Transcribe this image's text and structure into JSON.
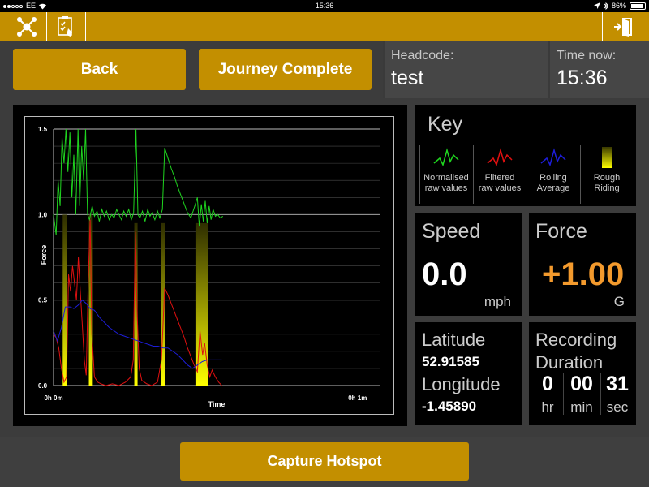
{
  "status_bar": {
    "carrier": "EE",
    "time": "15:36",
    "battery": "86%",
    "battery_fraction": 0.86
  },
  "toolbar": {
    "left_icons": [
      "network-icon",
      "checklist-icon"
    ],
    "right_icon": "exit-door-icon"
  },
  "header": {
    "back_label": "Back",
    "journey_label": "Journey Complete",
    "headcode_label": "Headcode:",
    "headcode_value": "test",
    "time_label": "Time now:",
    "time_value": "15:36"
  },
  "chart_data": {
    "type": "line",
    "xlabel": "Time",
    "ylabel": "Force",
    "x_tick_labels": [
      "0h 0m",
      "0h 1m"
    ],
    "y_ticks": [
      "0.0",
      "0.5",
      "1.0",
      "1.5"
    ],
    "ylim": [
      0,
      1.5
    ],
    "xlim": [
      0,
      1
    ],
    "grid": true,
    "series": [
      {
        "name": "Normalised raw values",
        "color": "#1fd41f",
        "points": [
          [
            0.0,
            1.0
          ],
          [
            0.008,
            0.88
          ],
          [
            0.014,
            1.2
          ],
          [
            0.02,
            1.05
          ],
          [
            0.026,
            1.45
          ],
          [
            0.032,
            1.3
          ],
          [
            0.038,
            1.52
          ],
          [
            0.044,
            1.25
          ],
          [
            0.05,
            1.48
          ],
          [
            0.056,
            1.1
          ],
          [
            0.062,
            1.35
          ],
          [
            0.068,
            1.0
          ],
          [
            0.075,
            1.5
          ],
          [
            0.08,
            1.05
          ],
          [
            0.086,
            1.4
          ],
          [
            0.092,
            1.2
          ],
          [
            0.098,
            1.52
          ],
          [
            0.104,
            1.0
          ],
          [
            0.11,
            0.97
          ],
          [
            0.118,
            1.05
          ],
          [
            0.125,
            0.99
          ],
          [
            0.133,
            1.02
          ],
          [
            0.14,
            0.96
          ],
          [
            0.148,
            1.03
          ],
          [
            0.155,
            0.99
          ],
          [
            0.162,
            1.02
          ],
          [
            0.17,
            0.97
          ],
          [
            0.178,
            1.0
          ],
          [
            0.185,
            0.98
          ],
          [
            0.193,
            1.03
          ],
          [
            0.2,
            1.0
          ],
          [
            0.208,
            0.97
          ],
          [
            0.215,
            1.02
          ],
          [
            0.222,
            0.99
          ],
          [
            0.23,
            1.03
          ],
          [
            0.238,
            0.97
          ],
          [
            0.245,
            1.01
          ],
          [
            0.252,
            1.52
          ],
          [
            0.258,
            1.0
          ],
          [
            0.264,
            0.98
          ],
          [
            0.272,
            1.02
          ],
          [
            0.28,
            0.96
          ],
          [
            0.288,
            1.03
          ],
          [
            0.295,
            0.99
          ],
          [
            0.302,
            1.01
          ],
          [
            0.31,
            0.97
          ],
          [
            0.318,
            1.02
          ],
          [
            0.325,
            0.98
          ],
          [
            0.333,
            1.03
          ],
          [
            0.34,
            1.39
          ],
          [
            0.35,
            1.33
          ],
          [
            0.36,
            1.27
          ],
          [
            0.37,
            1.22
          ],
          [
            0.38,
            1.16
          ],
          [
            0.39,
            1.11
          ],
          [
            0.4,
            1.06
          ],
          [
            0.41,
            1.01
          ],
          [
            0.42,
            0.98
          ],
          [
            0.432,
            1.05
          ],
          [
            0.44,
            1.1
          ],
          [
            0.446,
            0.93
          ],
          [
            0.452,
            1.06
          ],
          [
            0.458,
            0.96
          ],
          [
            0.464,
            1.08
          ],
          [
            0.47,
            0.95
          ],
          [
            0.476,
            1.05
          ],
          [
            0.482,
            0.97
          ],
          [
            0.488,
            1.03
          ],
          [
            0.495,
            0.99
          ],
          [
            0.502,
            1.0
          ],
          [
            0.51,
            0.98
          ],
          [
            0.518,
            0.99
          ]
        ]
      },
      {
        "name": "Filtered raw values",
        "color": "#e01010",
        "points": [
          [
            0.0,
            0.3
          ],
          [
            0.008,
            0.28
          ],
          [
            0.016,
            0.22
          ],
          [
            0.024,
            0.1
          ],
          [
            0.032,
            0.02
          ],
          [
            0.04,
            0.05
          ],
          [
            0.046,
            0.65
          ],
          [
            0.052,
            0.55
          ],
          [
            0.058,
            0.7
          ],
          [
            0.064,
            0.6
          ],
          [
            0.07,
            0.5
          ],
          [
            0.076,
            0.75
          ],
          [
            0.082,
            0.55
          ],
          [
            0.088,
            0.35
          ],
          [
            0.094,
            0.15
          ],
          [
            0.1,
            0.06
          ],
          [
            0.106,
            0.6
          ],
          [
            0.112,
            0.97
          ],
          [
            0.117,
            0.3
          ],
          [
            0.125,
            0.05
          ],
          [
            0.135,
            0.02
          ],
          [
            0.145,
            0.01
          ],
          [
            0.16,
            0.0
          ],
          [
            0.18,
            0.01
          ],
          [
            0.2,
            0.0
          ],
          [
            0.22,
            0.02
          ],
          [
            0.236,
            0.05
          ],
          [
            0.244,
            0.15
          ],
          [
            0.25,
            0.9
          ],
          [
            0.256,
            0.4
          ],
          [
            0.262,
            0.1
          ],
          [
            0.27,
            0.03
          ],
          [
            0.285,
            0.01
          ],
          [
            0.3,
            0.0
          ],
          [
            0.318,
            0.02
          ],
          [
            0.33,
            0.15
          ],
          [
            0.34,
            0.57
          ],
          [
            0.35,
            0.53
          ],
          [
            0.36,
            0.48
          ],
          [
            0.37,
            0.43
          ],
          [
            0.38,
            0.38
          ],
          [
            0.39,
            0.33
          ],
          [
            0.4,
            0.28
          ],
          [
            0.41,
            0.22
          ],
          [
            0.42,
            0.17
          ],
          [
            0.43,
            0.12
          ],
          [
            0.44,
            0.08
          ],
          [
            0.448,
            0.32
          ],
          [
            0.456,
            0.18
          ],
          [
            0.462,
            0.25
          ],
          [
            0.47,
            0.12
          ],
          [
            0.478,
            0.05
          ],
          [
            0.485,
            0.09
          ],
          [
            0.495,
            0.05
          ],
          [
            0.505,
            0.02
          ],
          [
            0.515,
            0.0
          ]
        ]
      },
      {
        "name": "Rolling Average",
        "color": "#1d1dd8",
        "points": [
          [
            0.0,
            0.32
          ],
          [
            0.012,
            0.26
          ],
          [
            0.024,
            0.34
          ],
          [
            0.036,
            0.46
          ],
          [
            0.05,
            0.46
          ],
          [
            0.062,
            0.45
          ],
          [
            0.075,
            0.47
          ],
          [
            0.088,
            0.5
          ],
          [
            0.1,
            0.48
          ],
          [
            0.112,
            0.45
          ],
          [
            0.125,
            0.44
          ],
          [
            0.14,
            0.4
          ],
          [
            0.155,
            0.37
          ],
          [
            0.17,
            0.34
          ],
          [
            0.185,
            0.32
          ],
          [
            0.2,
            0.3
          ],
          [
            0.215,
            0.29
          ],
          [
            0.23,
            0.28
          ],
          [
            0.245,
            0.27
          ],
          [
            0.26,
            0.26
          ],
          [
            0.275,
            0.25
          ],
          [
            0.29,
            0.24
          ],
          [
            0.305,
            0.23
          ],
          [
            0.32,
            0.23
          ],
          [
            0.335,
            0.22
          ],
          [
            0.35,
            0.22
          ],
          [
            0.365,
            0.2
          ],
          [
            0.38,
            0.18
          ],
          [
            0.395,
            0.15
          ],
          [
            0.41,
            0.12
          ],
          [
            0.425,
            0.1
          ],
          [
            0.44,
            0.12
          ],
          [
            0.455,
            0.14
          ],
          [
            0.47,
            0.15
          ],
          [
            0.485,
            0.15
          ],
          [
            0.5,
            0.15
          ],
          [
            0.515,
            0.15
          ]
        ]
      }
    ],
    "rough_riding_bands": [
      {
        "x_start": 0.028,
        "x_end": 0.04,
        "y_top": 1.0
      },
      {
        "x_start": 0.108,
        "x_end": 0.12,
        "y_top": 1.0
      },
      {
        "x_start": 0.247,
        "x_end": 0.257,
        "y_top": 0.95
      },
      {
        "x_start": 0.33,
        "x_end": 0.342,
        "y_top": 0.95
      },
      {
        "x_start": 0.434,
        "x_end": 0.472,
        "y_top": 0.95
      }
    ]
  },
  "key": {
    "title": "Key",
    "items": [
      {
        "line1": "Normalised",
        "line2": "raw values",
        "color": "#1fd41f"
      },
      {
        "line1": "Filtered",
        "line2": "raw values",
        "color": "#e01010"
      },
      {
        "line1": "Rolling",
        "line2": "Average",
        "color": "#1d1dd8"
      },
      {
        "line1": "Rough",
        "line2": "Riding",
        "color": "#e8e800"
      }
    ]
  },
  "speed": {
    "title": "Speed",
    "value": "0.0",
    "unit": "mph"
  },
  "force": {
    "title": "Force",
    "value": "+1.00",
    "unit": "G",
    "value_color": "#f39a2d"
  },
  "location": {
    "lat_label": "Latitude",
    "lat_value": "52.91585",
    "lon_label": "Longitude",
    "lon_value": "-1.45890"
  },
  "duration": {
    "title_line1": "Recording",
    "title_line2": "Duration",
    "hours": "0",
    "hours_unit": "hr",
    "minutes": "00",
    "minutes_unit": "min",
    "seconds": "31",
    "seconds_unit": "sec"
  },
  "bottom": {
    "capture_label": "Capture Hotspot"
  }
}
